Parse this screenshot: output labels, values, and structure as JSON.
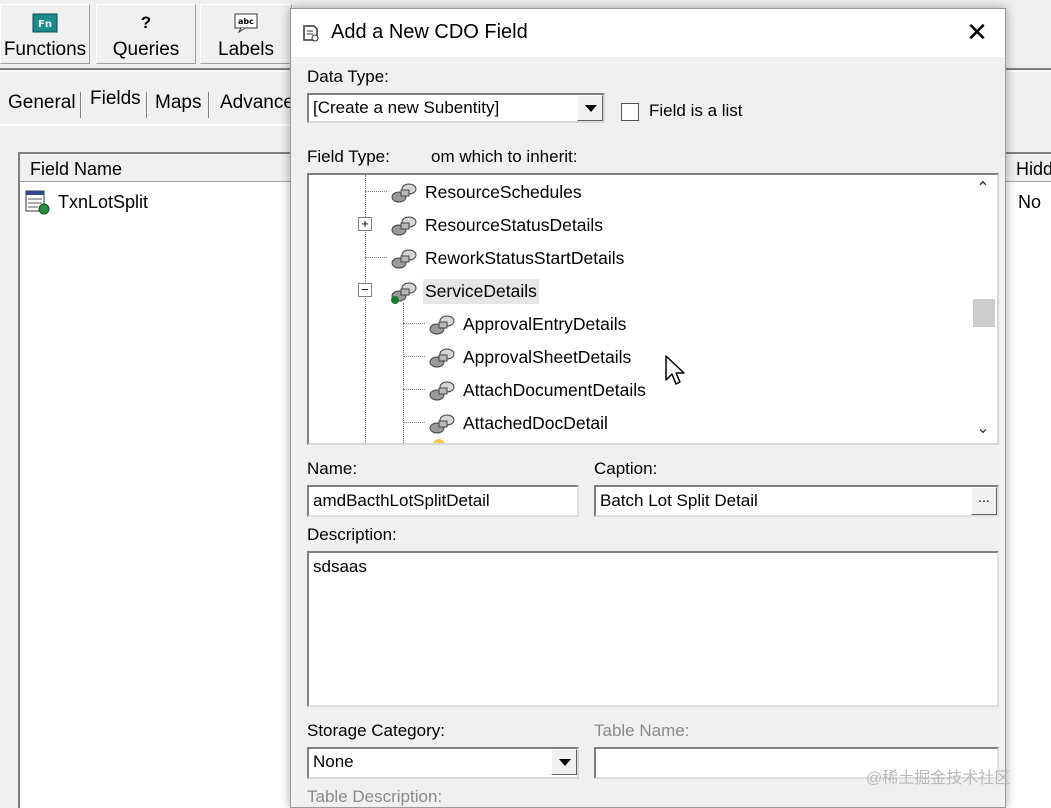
{
  "toolbar": {
    "buttons": [
      {
        "label": "Functions",
        "icon": "functions-icon"
      },
      {
        "label": "Queries",
        "icon": "question-icon"
      },
      {
        "label": "Labels",
        "icon": "labels-icon"
      }
    ]
  },
  "tabs": [
    {
      "label": "General"
    },
    {
      "label": "Fields",
      "active": true
    },
    {
      "label": "Maps"
    },
    {
      "label": "Advance"
    }
  ],
  "field_list": {
    "header": "Field Name",
    "rows": [
      {
        "name": "TxnLotSplit"
      }
    ]
  },
  "right_column": {
    "header": "Hidd",
    "value": "No"
  },
  "dialog": {
    "title": "Add a New CDO Field",
    "close_glyph": "✕",
    "data_type_label": "Data Type:",
    "data_type_value": "[Create a new Subentity]",
    "field_is_list_label": "Field is a list",
    "field_type_label": "Field Type:",
    "inherit_label": "om which to inherit:",
    "tree": {
      "items": [
        {
          "label": "ResourceSchedules",
          "level": 1
        },
        {
          "label": "ResourceStatusDetails",
          "level": 1,
          "expander": "+"
        },
        {
          "label": "ReworkStatusStartDetails",
          "level": 1
        },
        {
          "label": "ServiceDetails",
          "level": 1,
          "expander": "−",
          "selected": true
        },
        {
          "label": "ApprovalEntryDetails",
          "level": 2
        },
        {
          "label": "ApprovalSheetDetails",
          "level": 2
        },
        {
          "label": "AttachDocumentDetails",
          "level": 2
        },
        {
          "label": "AttachedDocDetail",
          "level": 2
        }
      ],
      "scroll_up": "⌃",
      "scroll_down": "⌄"
    },
    "name_label": "Name:",
    "name_value": "amdBacthLotSplitDetail",
    "caption_label": "Caption:",
    "caption_value": "Batch Lot Split Detail",
    "caption_button": "...",
    "description_label": "Description:",
    "description_value": "sdsaas",
    "storage_category_label": "Storage Category:",
    "storage_category_value": "None",
    "table_name_label": "Table Name:",
    "table_description_label": "Table Description:"
  },
  "watermark": "@稀土掘金技术社区",
  "colors": {
    "window_bg": "#f0f0f0",
    "field_bg": "#ffffff",
    "disabled_text": "#8a8a8a"
  }
}
